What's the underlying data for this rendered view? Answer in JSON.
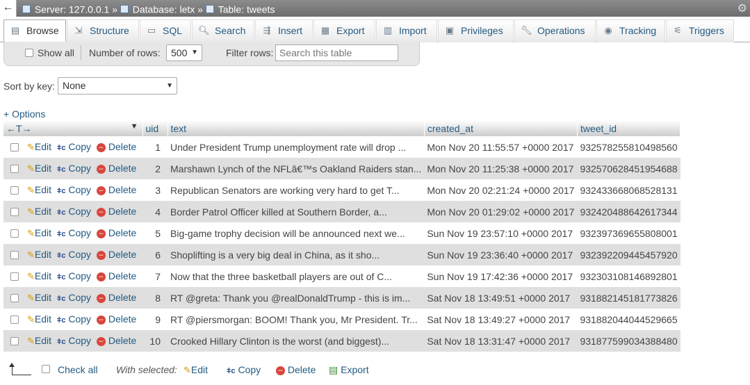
{
  "breadcrumb": {
    "server": "Server: 127.0.0.1",
    "sep": "»",
    "database": "Database: letx",
    "table": "Table: tweets"
  },
  "tabs": [
    {
      "label": "Browse",
      "icon": "browse-icon"
    },
    {
      "label": "Structure",
      "icon": "structure-icon"
    },
    {
      "label": "SQL",
      "icon": "sql-icon"
    },
    {
      "label": "Search",
      "icon": "search-icon"
    },
    {
      "label": "Insert",
      "icon": "insert-icon"
    },
    {
      "label": "Export",
      "icon": "export-icon"
    },
    {
      "label": "Import",
      "icon": "import-icon"
    },
    {
      "label": "Privileges",
      "icon": "privileges-icon"
    },
    {
      "label": "Operations",
      "icon": "wrench-icon"
    },
    {
      "label": "Tracking",
      "icon": "eye-icon"
    },
    {
      "label": "Triggers",
      "icon": "triggers-icon"
    }
  ],
  "controls": {
    "show_all": "Show all",
    "num_rows_label": "Number of rows:",
    "num_rows_value": "500",
    "filter_label": "Filter rows:",
    "filter_placeholder": "Search this table",
    "sort_label": "Sort by key:",
    "sort_value": "None",
    "options": "+ Options"
  },
  "columns": [
    "uid",
    "text",
    "created_at",
    "tweet_id"
  ],
  "actions": {
    "edit": "Edit",
    "copy": "Copy",
    "delete": "Delete"
  },
  "rows": [
    {
      "uid": "1",
      "text": "Under President Trump unemployment rate will drop ...",
      "created_at": "Mon Nov 20 11:55:57 +0000 2017",
      "tweet_id": "932578255810498560"
    },
    {
      "uid": "2",
      "text": "Marshawn Lynch of the NFLâ€™s Oakland Raiders stan...",
      "created_at": "Mon Nov 20 11:25:38 +0000 2017",
      "tweet_id": "932570628451954688"
    },
    {
      "uid": "3",
      "text": "Republican Senators are working very hard to get T...",
      "created_at": "Mon Nov 20 02:21:24 +0000 2017",
      "tweet_id": "932433668068528131"
    },
    {
      "uid": "4",
      "text": "Border Patrol Officer killed at Southern Border, a...",
      "created_at": "Mon Nov 20 01:29:02 +0000 2017",
      "tweet_id": "932420488642617344"
    },
    {
      "uid": "5",
      "text": "Big-game trophy decision will be announced next we...",
      "created_at": "Sun Nov 19 23:57:10 +0000 2017",
      "tweet_id": "932397369655808001"
    },
    {
      "uid": "6",
      "text": "Shoplifting is a very big deal in China, as it sho...",
      "created_at": "Sun Nov 19 23:36:40 +0000 2017",
      "tweet_id": "932392209445457920"
    },
    {
      "uid": "7",
      "text": "Now that the three basketball players are out of C...",
      "created_at": "Sun Nov 19 17:42:36 +0000 2017",
      "tweet_id": "932303108146892801"
    },
    {
      "uid": "8",
      "text": "RT @greta: Thank you @realDonaldTrump - this is im...",
      "created_at": "Sat Nov 18 13:49:51 +0000 2017",
      "tweet_id": "931882145181773826"
    },
    {
      "uid": "9",
      "text": "RT @piersmorgan: BOOM! Thank you, Mr President. Tr...",
      "created_at": "Sat Nov 18 13:49:27 +0000 2017",
      "tweet_id": "931882044044529665"
    },
    {
      "uid": "10",
      "text": "Crooked Hillary Clinton is the worst (and biggest)...",
      "created_at": "Sat Nov 18 13:31:47 +0000 2017",
      "tweet_id": "931877599034388480"
    }
  ],
  "bottom": {
    "check_all": "Check all",
    "with_selected": "With selected:",
    "edit": "Edit",
    "copy": "Copy",
    "delete": "Delete",
    "export": "Export"
  }
}
